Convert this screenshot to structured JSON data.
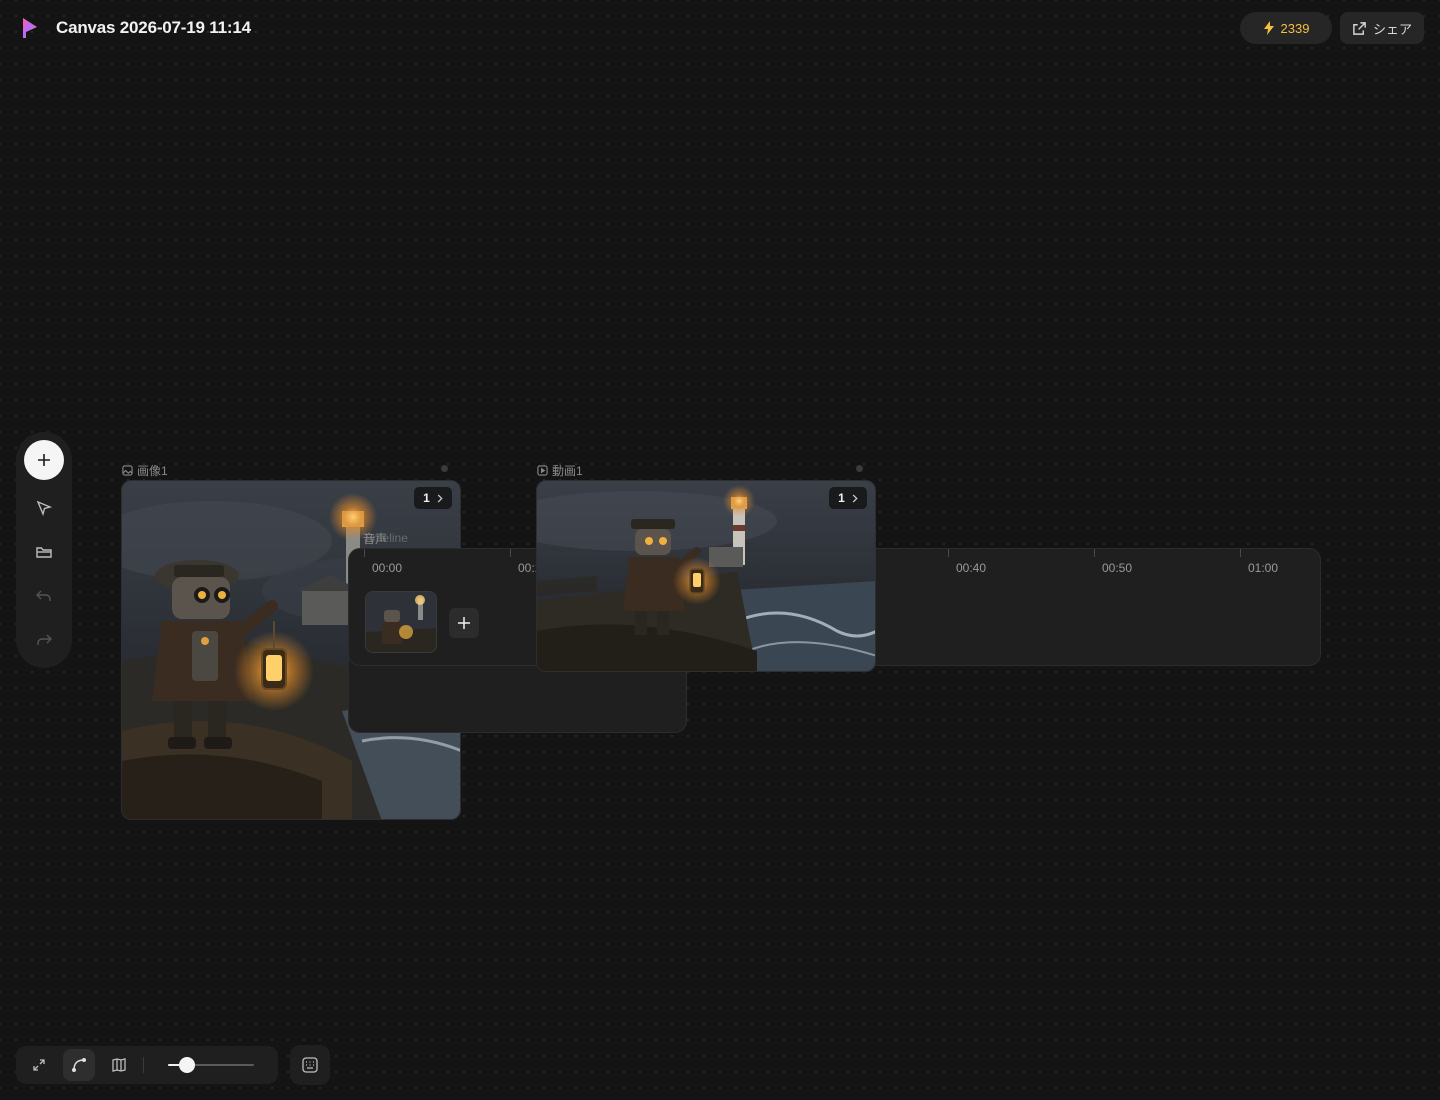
{
  "header": {
    "title": "Canvas 2026-07-19 11:14",
    "credits": "2339",
    "share_label": "シェア"
  },
  "toolbar": {
    "tools": [
      "plus-icon",
      "cursor-icon",
      "folder-icon",
      "undo-icon",
      "redo-icon"
    ]
  },
  "nodes": {
    "image": {
      "label": "画像1",
      "count": "1"
    },
    "video": {
      "label": "動画1",
      "count": "1"
    },
    "timeline": {
      "label": "音声",
      "label_overlay": "Timeline",
      "ticks": [
        "00:00",
        "00:10",
        "00:40",
        "00:50",
        "01:00"
      ]
    }
  },
  "bottom_bar": {
    "zoom_fraction": 0.22
  },
  "colors": {
    "background": "#141414",
    "panel": "#1f1f1f",
    "credits": "#f5c040"
  }
}
